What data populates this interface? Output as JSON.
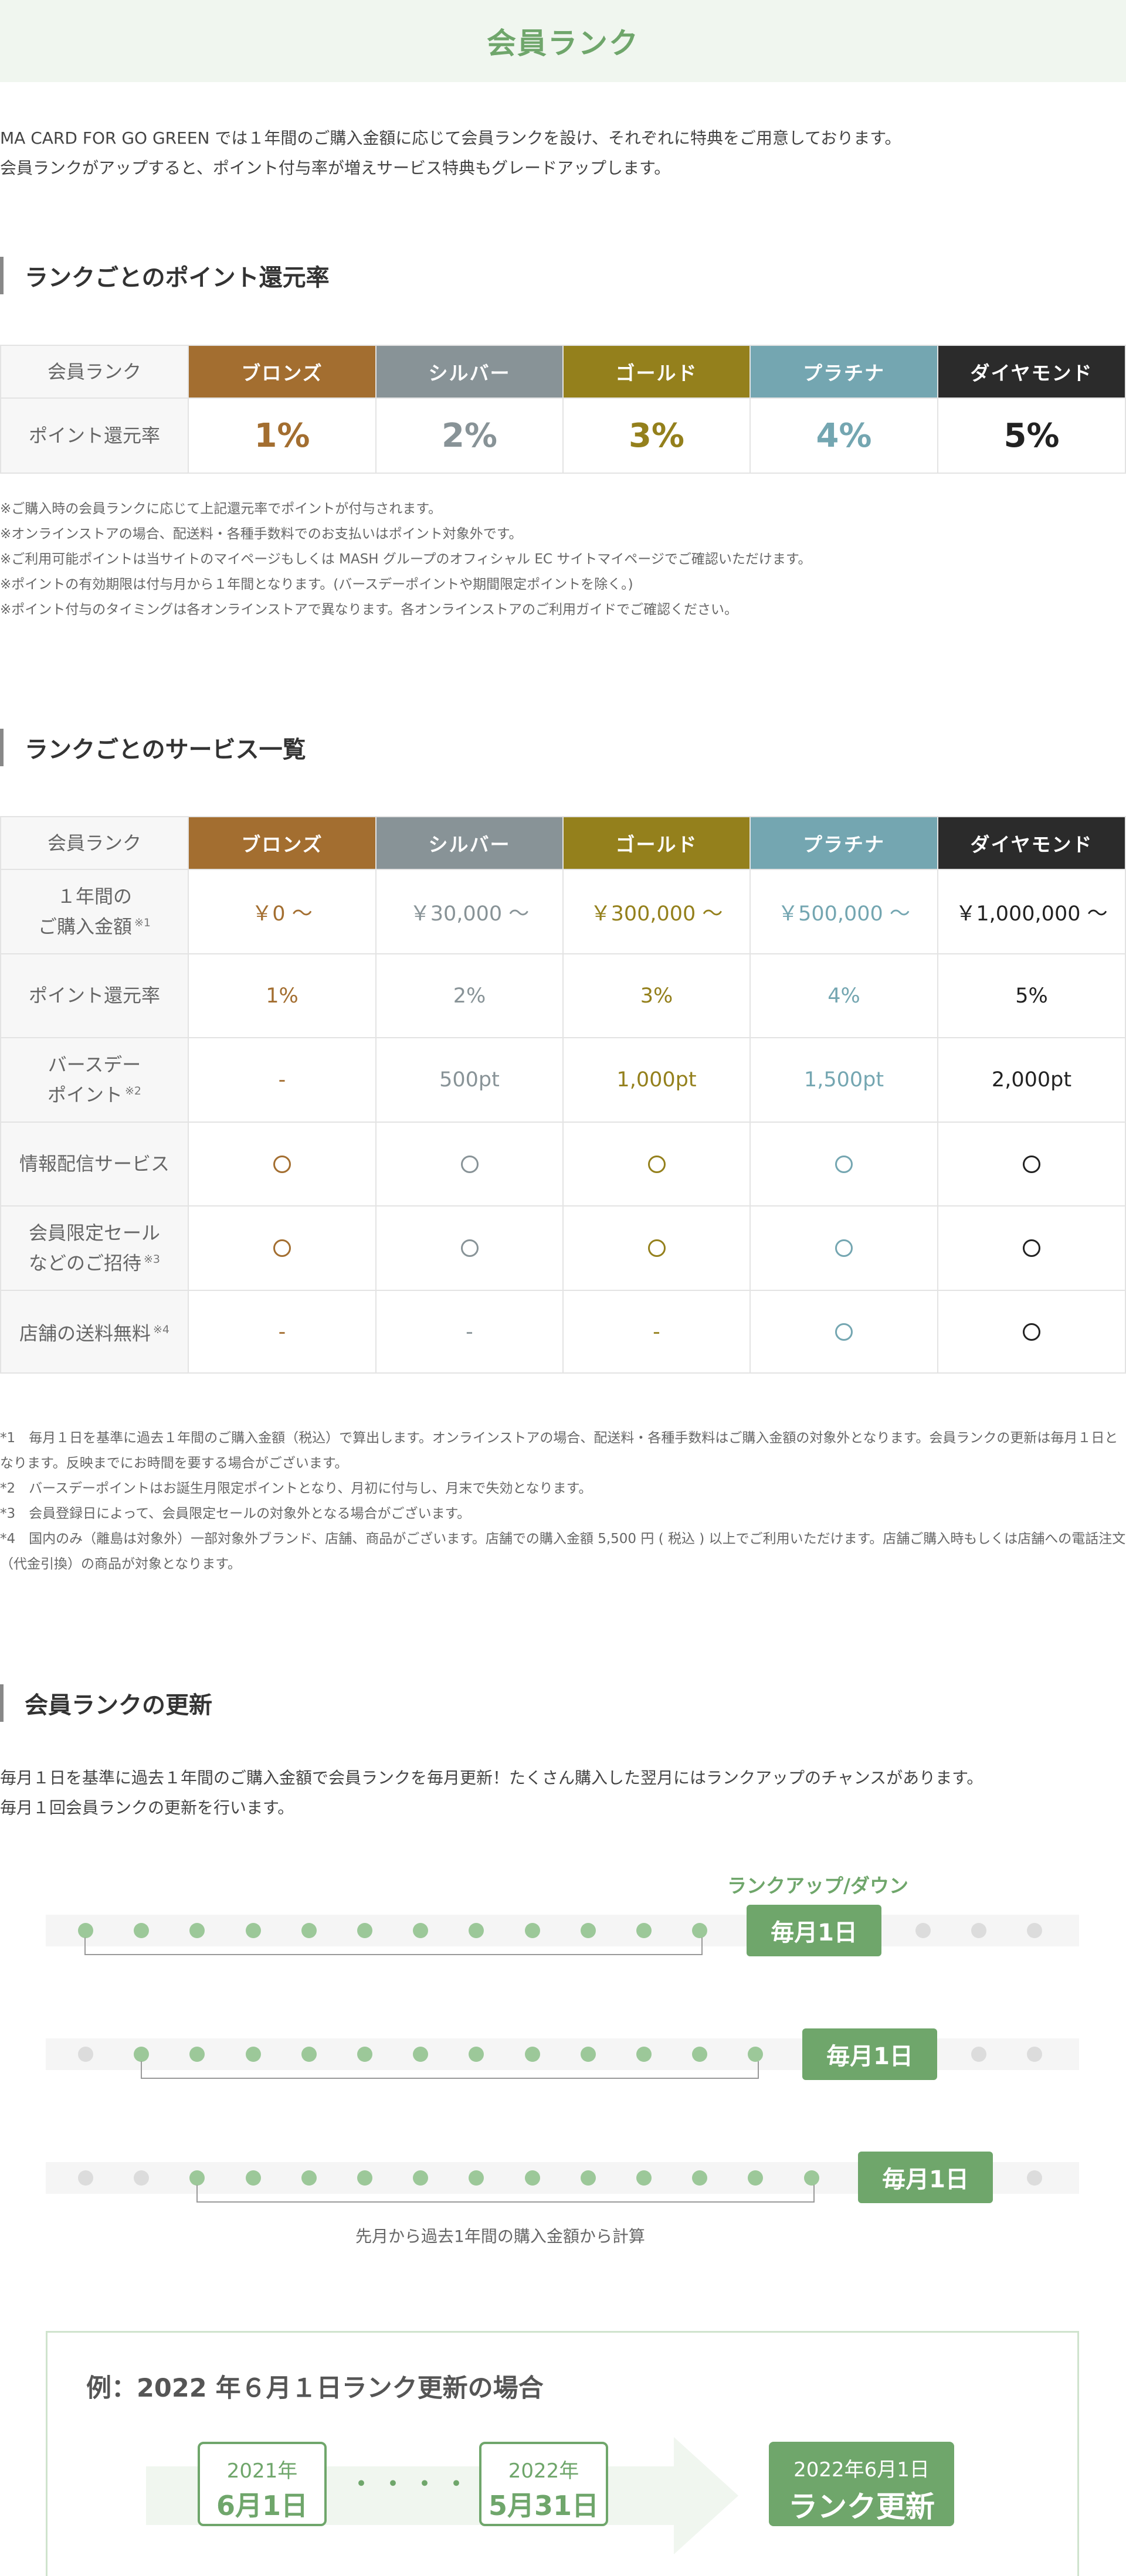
{
  "page_title": "会員ランク",
  "intro": [
    "MA CARD FOR GO GREEN では１年間のご購入金額に応じて会員ランクを設け、それぞれに特典をご用意しております。",
    "会員ランクがアップすると、ポイント付与率が増えサービス特典もグレードアップします。"
  ],
  "section1": {
    "heading": "ランクごとのポイント還元率",
    "header_label": "会員ランク",
    "row_label": "ポイント還元率",
    "ranks": [
      "ブロンズ",
      "シルバー",
      "ゴールド",
      "プラチナ",
      "ダイヤモンド"
    ],
    "rates": [
      "1%",
      "2%",
      "3%",
      "4%",
      "5%"
    ],
    "notes": [
      "※ご購入時の会員ランクに応じて上記還元率でポイントが付与されます。",
      "※オンラインストアの場合、配送料・各種手数料でのお支払いはポイント対象外です。",
      "※ご利用可能ポイントは当サイトのマイページもしくは MASH グループのオフィシャル EC サイトマイページでご確認いただけます。",
      "※ポイントの有効期限は付与月から１年間となります。(バースデーポイントや期間限定ポイントを除く。)",
      "※ポイント付与のタイミングは各オンラインストアで異なります。各オンラインストアのご利用ガイドでご確認ください。"
    ]
  },
  "section2": {
    "heading": "ランクごとのサービス一覧",
    "header_label": "会員ランク",
    "ranks": [
      "ブロンズ",
      "シルバー",
      "ゴールド",
      "プラチナ",
      "ダイヤモンド"
    ],
    "rows": [
      {
        "label1": "１年間の",
        "label2": "ご購入金額",
        "note": "※1",
        "values": [
          "￥0 〜",
          "￥30,000 〜",
          "￥300,000 〜",
          "￥500,000 〜",
          "￥1,000,000 〜"
        ]
      },
      {
        "label1": "ポイント還元率",
        "label2": "",
        "note": "",
        "values": [
          "1%",
          "2%",
          "3%",
          "4%",
          "5%"
        ]
      },
      {
        "label1": "バースデー",
        "label2": "ポイント",
        "note": "※2",
        "values": [
          "-",
          "500pt",
          "1,000pt",
          "1,500pt",
          "2,000pt"
        ]
      },
      {
        "label1": "情報配信サービス",
        "label2": "",
        "note": "",
        "values": [
          "circle",
          "circle",
          "circle",
          "circle",
          "circle"
        ]
      },
      {
        "label1": "会員限定セール",
        "label2": "などのご招待",
        "note": "※3",
        "values": [
          "circle",
          "circle",
          "circle",
          "circle",
          "circle"
        ]
      },
      {
        "label1": "店舗の送料無料",
        "label2": "",
        "note": "※4",
        "values": [
          "-",
          "-",
          "-",
          "circle",
          "circle"
        ]
      }
    ],
    "notes": [
      "*1　毎月１日を基準に過去１年間のご購入金額（税込）で算出します。オンラインストアの場合、配送料・各種手数料はご購入金額の対象外となります。会員ランクの更新は毎月１日となります。反映までにお時間を要する場合がございます。",
      "*2　バースデーポイントはお誕生月限定ポイントとなり、月初に付与し、月末で失効となります。",
      "*3　会員登録日によって、会員限定セールの対象外となる場合がございます。",
      "*4　国内のみ（離島は対象外）一部対象外ブランド、店舗、商品がございます。店舗での購入金額 5,500 円 ( 税込 ) 以上でご利用いただけます。店舗ご購入時もしくは店舗への電話注文（代金引換）の商品が対象となります。"
    ]
  },
  "section3": {
    "heading": "会員ランクの更新",
    "intro": [
      "毎月１日を基準に過去１年間のご購入金額で会員ランクを毎月更新！たくさん購入した翌月にはランクアップのチャンスがあります。",
      "毎月１回会員ランクの更新を行います。"
    ],
    "rank_updown": "ランクアップ/ダウン",
    "month_label": "毎月1日",
    "calc_label": "先月から過去1年間の購入金額から計算",
    "example": {
      "title": "例：2022 年６月１日ランク更新の場合",
      "start_year": "2021年",
      "start_day": "6月1日",
      "end_year": "2022年",
      "end_day": "5月31日",
      "ellipsis": "・・・・・・",
      "update_date": "2022年6月1日",
      "update_label": "ランク更新"
    }
  },
  "colors": {
    "bronze": "#a36e30",
    "silver": "#889397",
    "gold": "#94801c",
    "platinum": "#74a6b1",
    "diamond": "#2b2b2b",
    "accent_green": "#6fa66b"
  }
}
